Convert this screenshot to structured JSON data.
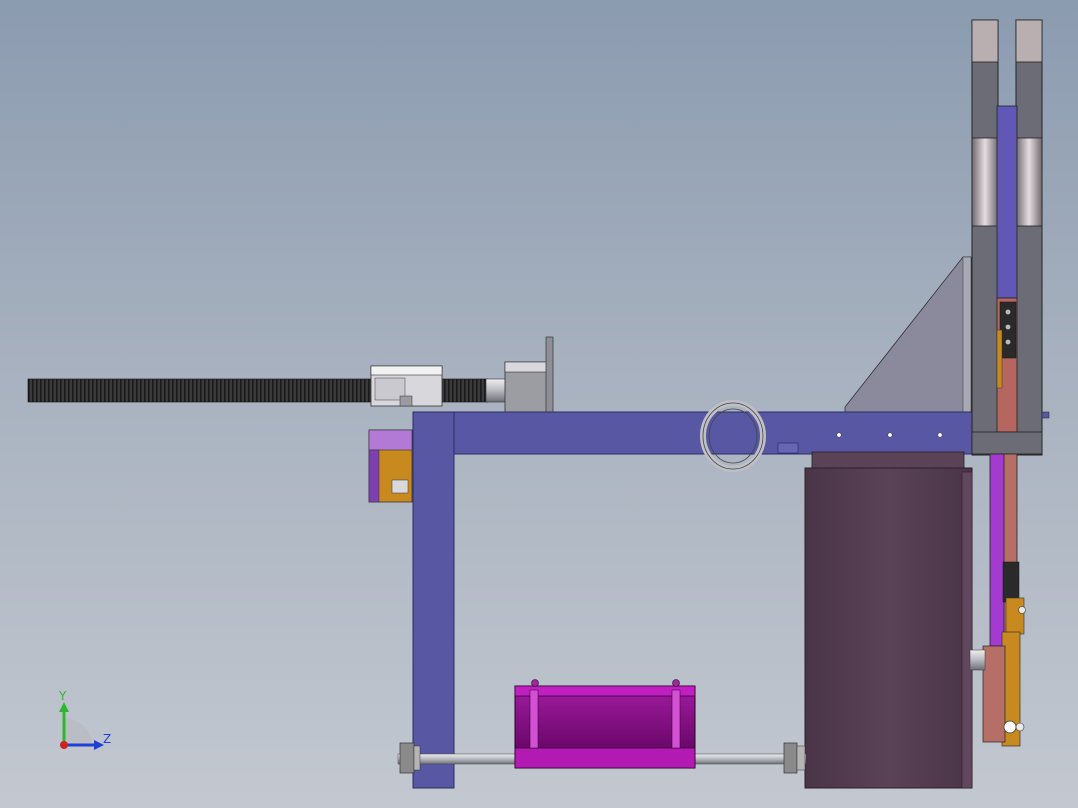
{
  "viewport": {
    "kind": "cad-3d-model-view",
    "background_colors": [
      "#8b9bb0",
      "#c3c8d0"
    ]
  },
  "triad": {
    "y_label": "Y",
    "z_label": "Z",
    "colors": {
      "y": "#2db82d",
      "z": "#1f3fd6",
      "x": "#d02020",
      "sphere": "#9aa0a8"
    }
  },
  "colors": {
    "frame": "#5857a3",
    "frame_edge": "#2c2b66",
    "gusset": "#8a8a9c",
    "cylinder": "#8a0b8a",
    "cylinder_light": "#c21fc2",
    "motor": "#523b4f",
    "steel": "#cfcfd4",
    "thread": "#2a2a2a",
    "brass": "#c88a1e",
    "link": "#b56f66",
    "nut": "#8a8a8a"
  }
}
